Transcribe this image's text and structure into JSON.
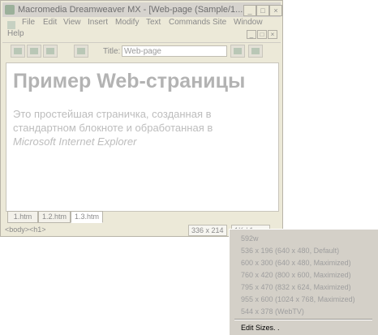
{
  "window": {
    "title": "Macromedia Dreamweaver MX - [Web-page (Sample/1...",
    "controls": [
      "_",
      "□",
      "×"
    ]
  },
  "menubar": {
    "items": [
      "File",
      "Edit",
      "View",
      "Insert",
      "Modify",
      "Text",
      "Commands",
      "Site",
      "Window",
      "Help"
    ],
    "doc_controls": [
      "_",
      "□",
      "×"
    ]
  },
  "toolbar": {
    "title_label": "Title:",
    "title_value": "Web-page"
  },
  "document": {
    "heading": "Пример Web-страницы",
    "paragraph_line1": "Это простейшая страничка, созданная в",
    "paragraph_line2": "стандартном блокноте и обработанная в",
    "paragraph_italic": "Microsoft Internet Explorer"
  },
  "tabs": [
    "1.htm",
    "1.2.htm",
    "1.3.htm"
  ],
  "status": {
    "tag_selector": "<body><h1>",
    "window_size": "336 x 214",
    "download": "1K / 1 sec"
  },
  "size_menu": {
    "items": [
      "592w",
      "536 x 196  (640 x 480, Default)",
      "600 x 300  (640 x 480, Maximized)",
      "760 x 420  (800 x 600, Maximized)",
      "795 x 470  (832 x 624, Maximized)",
      "955 x 600  (1024 x 768, Maximized)",
      "544 x 378  (WebTV)"
    ],
    "edit_sizes": "Edit Sizes. ."
  }
}
